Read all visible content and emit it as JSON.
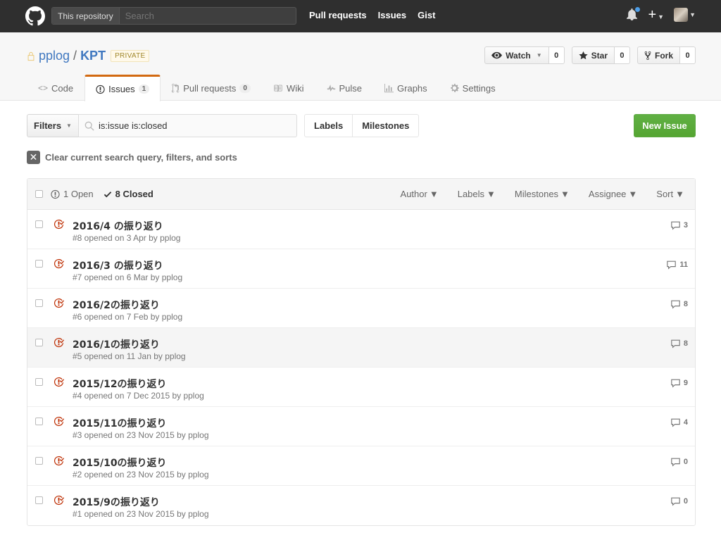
{
  "header": {
    "search_scope": "This repository",
    "search_placeholder": "Search",
    "nav": [
      "Pull requests",
      "Issues",
      "Gist"
    ]
  },
  "repo": {
    "owner": "pplog",
    "name": "KPT",
    "visibility": "PRIVATE",
    "watch_label": "Watch",
    "watch_count": "0",
    "star_label": "Star",
    "star_count": "0",
    "fork_label": "Fork",
    "fork_count": "0"
  },
  "reponav": {
    "code": "Code",
    "issues": "Issues",
    "issues_count": "1",
    "pulls": "Pull requests",
    "pulls_count": "0",
    "wiki": "Wiki",
    "pulse": "Pulse",
    "graphs": "Graphs",
    "settings": "Settings"
  },
  "subnav": {
    "filters_label": "Filters",
    "query": "is:issue is:closed",
    "labels": "Labels",
    "milestones": "Milestones",
    "new_issue": "New Issue",
    "clear": "Clear current search query, filters, and sorts"
  },
  "table": {
    "open_label": "1 Open",
    "closed_label": "8 Closed",
    "filters": [
      "Author",
      "Labels",
      "Milestones",
      "Assignee",
      "Sort"
    ]
  },
  "issues": [
    {
      "title": "2016/4 の振り返り",
      "meta": "#8 opened on 3 Apr by pplog",
      "comments": "3"
    },
    {
      "title": "2016/3 の振り返り",
      "meta": "#7 opened on 6 Mar by pplog",
      "comments": "11"
    },
    {
      "title": "2016/2の振り返り",
      "meta": "#6 opened on 7 Feb by pplog",
      "comments": "8"
    },
    {
      "title": "2016/1の振り返り",
      "meta": "#5 opened on 11 Jan by pplog",
      "comments": "8"
    },
    {
      "title": "2015/12の振り返り",
      "meta": "#4 opened on 7 Dec 2015 by pplog",
      "comments": "9"
    },
    {
      "title": "2015/11の振り返り",
      "meta": "#3 opened on 23 Nov 2015 by pplog",
      "comments": "4"
    },
    {
      "title": "2015/10の振り返り",
      "meta": "#2 opened on 23 Nov 2015 by pplog",
      "comments": "0"
    },
    {
      "title": "2015/9の振り返り",
      "meta": "#1 opened on 23 Nov 2015 by pplog",
      "comments": "0"
    }
  ]
}
